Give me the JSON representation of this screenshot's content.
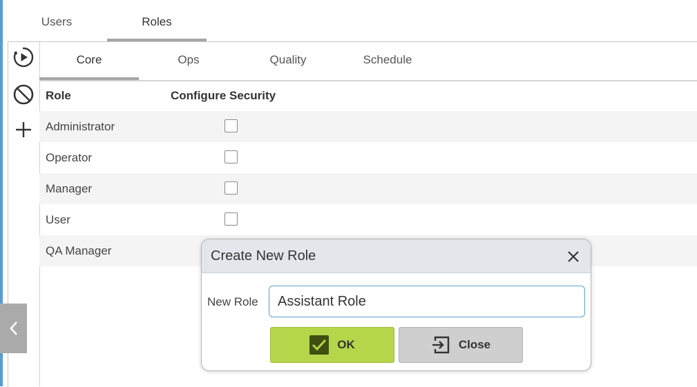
{
  "top_tabs": [
    {
      "label": "Users",
      "active": false
    },
    {
      "label": "Roles",
      "active": true
    }
  ],
  "toolbar": [
    {
      "icon": "play-circle-icon"
    },
    {
      "icon": "cancel-icon"
    },
    {
      "icon": "plus-icon"
    }
  ],
  "sub_tabs": [
    {
      "label": "Core",
      "active": true
    },
    {
      "label": "Ops",
      "active": false
    },
    {
      "label": "Quality",
      "active": false
    },
    {
      "label": "Schedule",
      "active": false
    }
  ],
  "grid": {
    "headers": {
      "role": "Role",
      "configure_security": "Configure Security"
    },
    "rows": [
      {
        "role": "Administrator",
        "configure_security": false
      },
      {
        "role": "Operator",
        "configure_security": false
      },
      {
        "role": "Manager",
        "configure_security": false
      },
      {
        "role": "User",
        "configure_security": false
      },
      {
        "role": "QA Manager",
        "configure_security": false
      }
    ]
  },
  "dialog": {
    "title": "Create New Role",
    "field_label": "New Role",
    "field_value": "Assistant Role",
    "ok_label": "OK",
    "close_label": "Close"
  },
  "colors": {
    "ok_button": "#b5d64a",
    "close_button": "#cfcfcf",
    "dialog_header": "#e3e7ec",
    "accent": "#5a9bd5"
  }
}
